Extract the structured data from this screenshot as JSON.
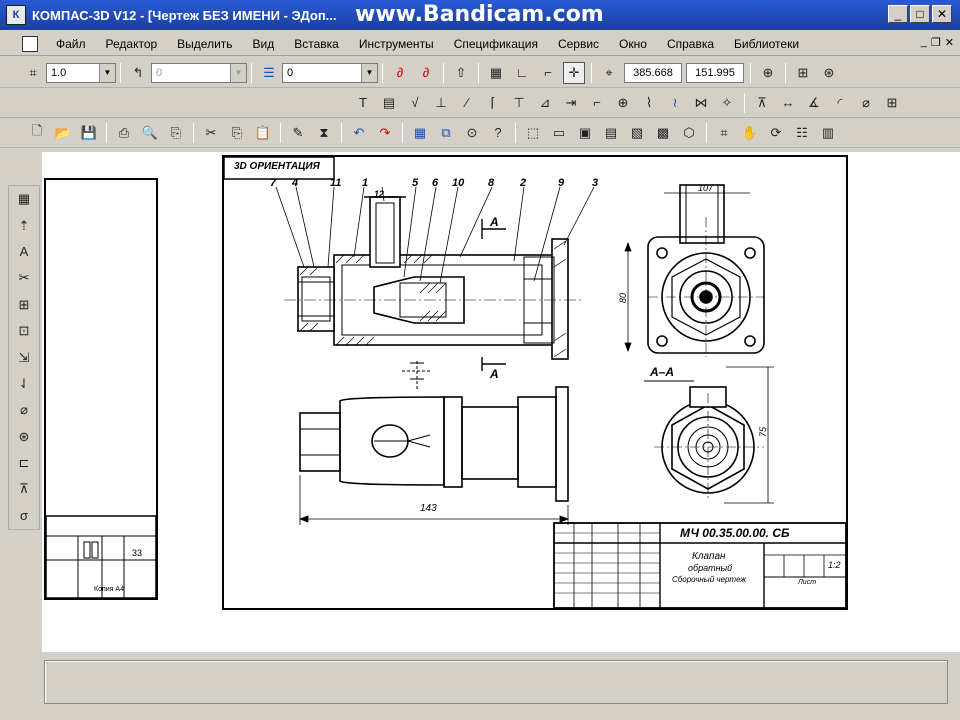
{
  "window": {
    "title": "КОМПАС-3D V12 - [Чертеж БЕЗ ИМЕНИ - ЭДоп...",
    "watermark": "www.Bandicam.com",
    "app_icon": "К"
  },
  "menu": {
    "items": [
      "Файл",
      "Редактор",
      "Выделить",
      "Вид",
      "Вставка",
      "Инструменты",
      "Спецификация",
      "Сервис",
      "Окно",
      "Справка",
      "Библиотеки"
    ]
  },
  "toolbar1": {
    "scale_value": "1.0",
    "style_value": "0",
    "layer_value": "0",
    "coord_x": "385.668",
    "coord_y": "151.995"
  },
  "drawing": {
    "view_label": "3D ОРИЕНТАЦИЯ",
    "callouts": [
      "7",
      "4",
      "11",
      "1",
      "12",
      "5",
      "6",
      "10",
      "8",
      "2",
      "9",
      "3"
    ],
    "section_mark_top": "А",
    "section_mark_bottom": "А",
    "section_title": "А–А",
    "dim_length": "143",
    "dim_width": "107",
    "dim_height": "80",
    "dim_side": "75",
    "doc_code": "МЧ 00.35.00.00. СБ",
    "part_name_1": "Клапан",
    "part_name_2": "обратный",
    "part_name_3": "Сборочный чертеж",
    "mass": "1:2",
    "sheet": "Лист"
  },
  "mini_sheet": {
    "stamp_value": "33",
    "caption": "Копия А4"
  }
}
